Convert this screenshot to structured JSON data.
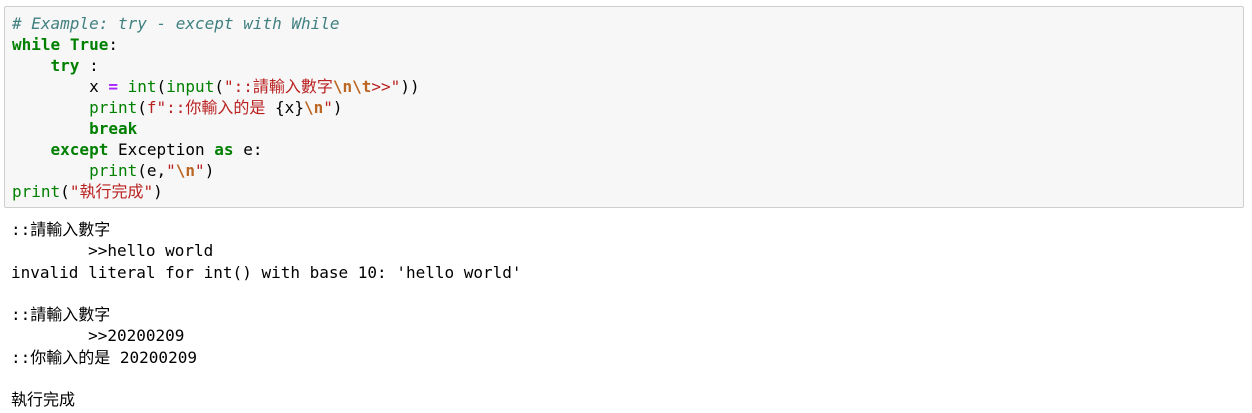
{
  "code_cell": {
    "lines": [
      [
        {
          "t": "# Example: try - except with While",
          "c": "cm"
        }
      ],
      [
        {
          "t": "while",
          "c": "kw"
        },
        {
          "t": " ",
          "c": "pl"
        },
        {
          "t": "True",
          "c": "kw"
        },
        {
          "t": ":",
          "c": "pl"
        }
      ],
      [
        {
          "t": "    ",
          "c": "pl"
        },
        {
          "t": "try",
          "c": "kw"
        },
        {
          "t": " :",
          "c": "pl"
        }
      ],
      [
        {
          "t": "        x ",
          "c": "pl"
        },
        {
          "t": "=",
          "c": "op"
        },
        {
          "t": " ",
          "c": "pl"
        },
        {
          "t": "int",
          "c": "bi"
        },
        {
          "t": "(",
          "c": "pl"
        },
        {
          "t": "input",
          "c": "bi"
        },
        {
          "t": "(",
          "c": "pl"
        },
        {
          "t": "\"::請輸入數字",
          "c": "st"
        },
        {
          "t": "\\n\\t",
          "c": "es"
        },
        {
          "t": ">>\"",
          "c": "st"
        },
        {
          "t": "))",
          "c": "pl"
        }
      ],
      [
        {
          "t": "        ",
          "c": "pl"
        },
        {
          "t": "print",
          "c": "bi"
        },
        {
          "t": "(",
          "c": "pl"
        },
        {
          "t": "f\"::你輸入的是 ",
          "c": "st"
        },
        {
          "t": "{x}",
          "c": "pl"
        },
        {
          "t": "\\n",
          "c": "es"
        },
        {
          "t": "\"",
          "c": "st"
        },
        {
          "t": ")",
          "c": "pl"
        }
      ],
      [
        {
          "t": "        ",
          "c": "pl"
        },
        {
          "t": "break",
          "c": "kw"
        }
      ],
      [
        {
          "t": "    ",
          "c": "pl"
        },
        {
          "t": "except",
          "c": "kw"
        },
        {
          "t": " Exception ",
          "c": "pl"
        },
        {
          "t": "as",
          "c": "kw"
        },
        {
          "t": " e:",
          "c": "pl"
        }
      ],
      [
        {
          "t": "        ",
          "c": "pl"
        },
        {
          "t": "print",
          "c": "bi"
        },
        {
          "t": "(e,",
          "c": "pl"
        },
        {
          "t": "\"",
          "c": "st"
        },
        {
          "t": "\\n",
          "c": "es"
        },
        {
          "t": "\"",
          "c": "st"
        },
        {
          "t": ")",
          "c": "pl"
        }
      ],
      [
        {
          "t": "print",
          "c": "bi"
        },
        {
          "t": "(",
          "c": "pl"
        },
        {
          "t": "\"執行完成\"",
          "c": "st"
        },
        {
          "t": ")",
          "c": "pl"
        }
      ]
    ]
  },
  "output_cell": {
    "lines": [
      "::請輸入數字",
      "\t>>hello world",
      "invalid literal for int() with base 10: 'hello world'",
      "",
      "::請輸入數字",
      "\t>>20200209",
      "::你輸入的是 20200209",
      "",
      "執行完成"
    ]
  },
  "colors": {
    "cell_background": "#f7f7f7",
    "cell_border": "#cfcfcf",
    "comment": "#408080",
    "keyword": "#008000",
    "builtin": "#008000",
    "operator": "#aa22ff",
    "string": "#ba2121",
    "escape": "#bb6622"
  }
}
